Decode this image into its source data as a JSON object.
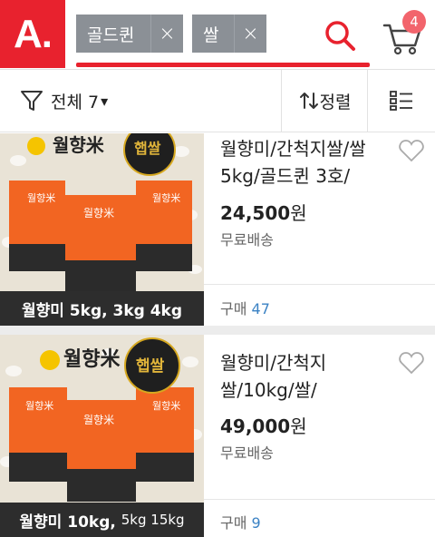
{
  "header": {
    "logo_text": "A.",
    "chips": [
      {
        "label": "골드퀸"
      },
      {
        "label": "쌀"
      }
    ],
    "chip_remove_glyph": "×",
    "search_icon": "search-icon",
    "cart_icon": "cart-icon",
    "cart_count": "4"
  },
  "filterbar": {
    "filter_label": "전체 7",
    "filter_caret": "▾",
    "sort_label": "정렬",
    "view_icon": "list-view-icon"
  },
  "products": [
    {
      "title": "월향미/간척지쌀/쌀5kg/골드퀸 3호/",
      "price": "24,500",
      "currency": "원",
      "shipping": "무료배송",
      "purchase_label": "구매",
      "purchase_count": "47",
      "caption_main": "월향미 5kg, 3kg 4kg",
      "caption_small": "",
      "badge_text": "햅쌀",
      "brand_text": "월향米"
    },
    {
      "title": "월향미/간척지쌀/10kg/쌀/",
      "price": "49,000",
      "currency": "원",
      "shipping": "무료배송",
      "purchase_label": "구매",
      "purchase_count": "9",
      "caption_main": "월향미 10kg,",
      "caption_small": "5kg 15kg",
      "badge_text": "햅쌀",
      "brand_text": "월향米"
    }
  ],
  "colors": {
    "brand_red": "#e8222e",
    "chip_gray": "#8b9096",
    "badge_pink": "#f2646c",
    "link_blue": "#3b82c4",
    "bag_orange": "#f26522"
  }
}
